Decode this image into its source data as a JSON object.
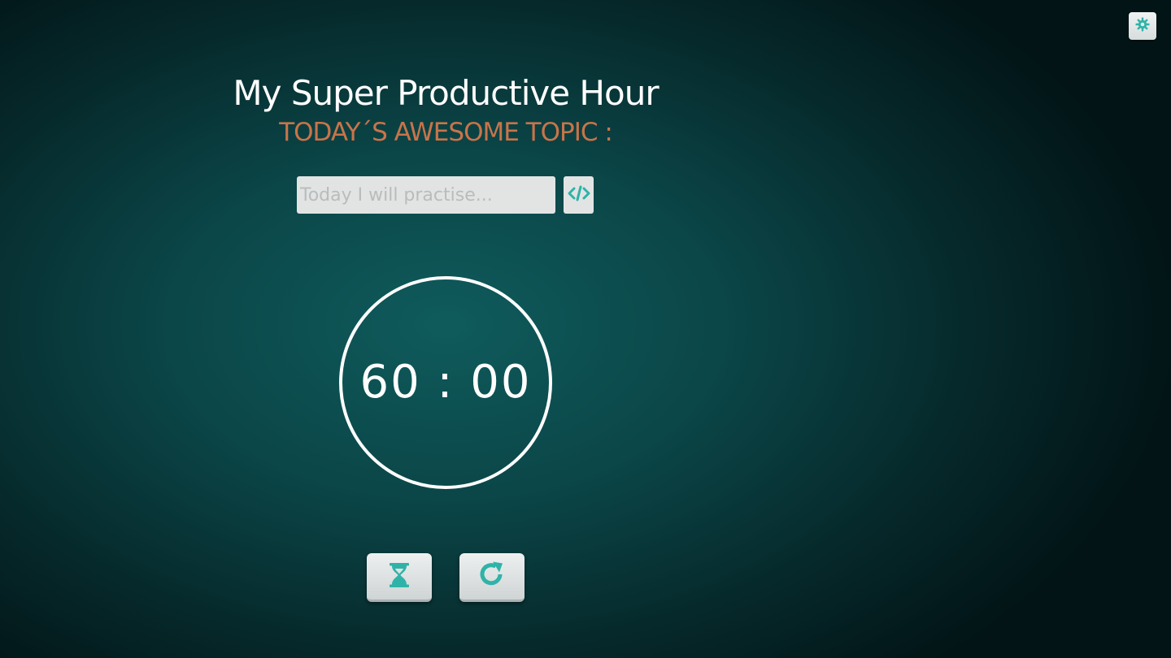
{
  "header": {
    "title": "My Super Productive Hour",
    "subtitle": "TODAY´S AWESOME TOPIC :"
  },
  "topic": {
    "value": "",
    "placeholder": "Today I will practise..."
  },
  "timer": {
    "display": "60 : 00"
  },
  "icons": {
    "settings": "gear-icon",
    "topic_submit": "code-icon",
    "start": "hourglass-icon",
    "reset": "refresh-icon"
  },
  "colors": {
    "accent": "#2fb3a8",
    "subtitle": "#c8744a",
    "background": "#0b4648",
    "text": "#ffffff"
  }
}
